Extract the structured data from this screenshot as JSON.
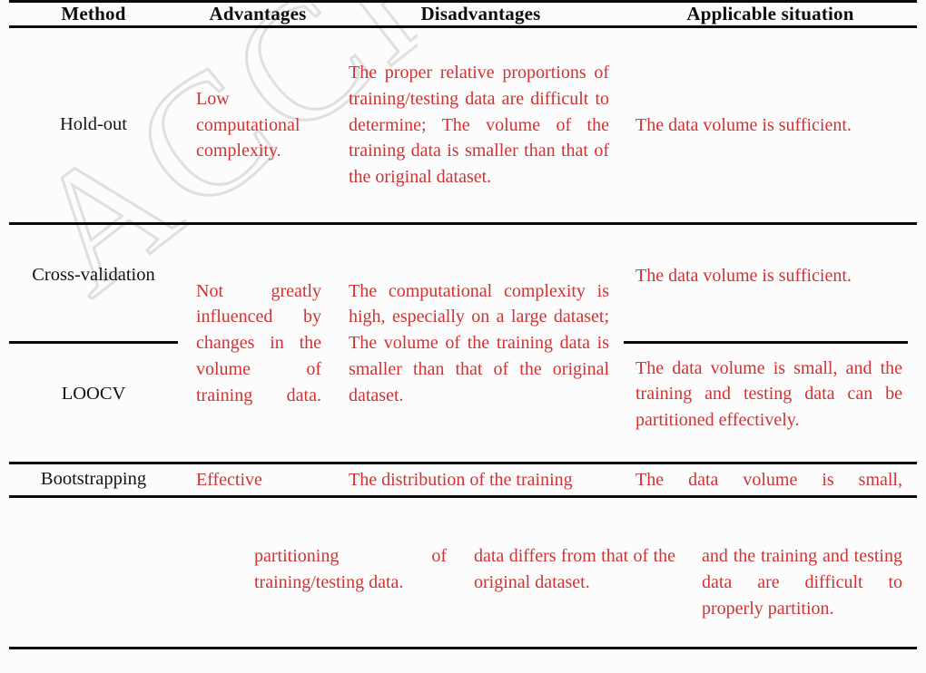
{
  "document": {
    "type": "academic-table",
    "accent_color": "#cf3333",
    "text_color": "#121212",
    "rule_color": "#0b0b0b",
    "watermark": "ACCEPT"
  },
  "table": {
    "headers": [
      "Method",
      "Advantages",
      "Disadvantages",
      "Applicable situation"
    ],
    "rows": [
      {
        "method": "Hold-out",
        "advantages": "Low computational complexity.",
        "disadvantages": "The proper relative proportions of training/testing data are difficult to determine; The volume of the training data is smaller than that of the original dataset.",
        "applicable": "The data volume is sufficient."
      },
      {
        "method": "Cross-validation",
        "advantages": "Not greatly influenced by changes in the volume of training data.",
        "disadvantages": "The computational complexity is high, especially on a large dataset; The volume of the training data is smaller than that of the original dataset.",
        "applicable": "The data volume is sufficient."
      },
      {
        "method": "LOOCV",
        "advantages": "",
        "disadvantages": "",
        "applicable": "The data volume is small, and the training and testing data can be partitioned effectively."
      },
      {
        "method": "Bootstrapping",
        "advantages": "Effective",
        "disadvantages": "The distribution of the training",
        "applicable": "The data volume is small,"
      }
    ],
    "continuation": {
      "advantages": "partitioning of training/testing data.",
      "disadvantages": "data differs from that of the original dataset.",
      "applicable": "and the training and testing data are difficult to properly partition."
    },
    "merged_cells": {
      "advantages_spans_cross_validation_and_loocv": true,
      "disadvantages_spans_cross_validation_and_loocv": true
    }
  }
}
